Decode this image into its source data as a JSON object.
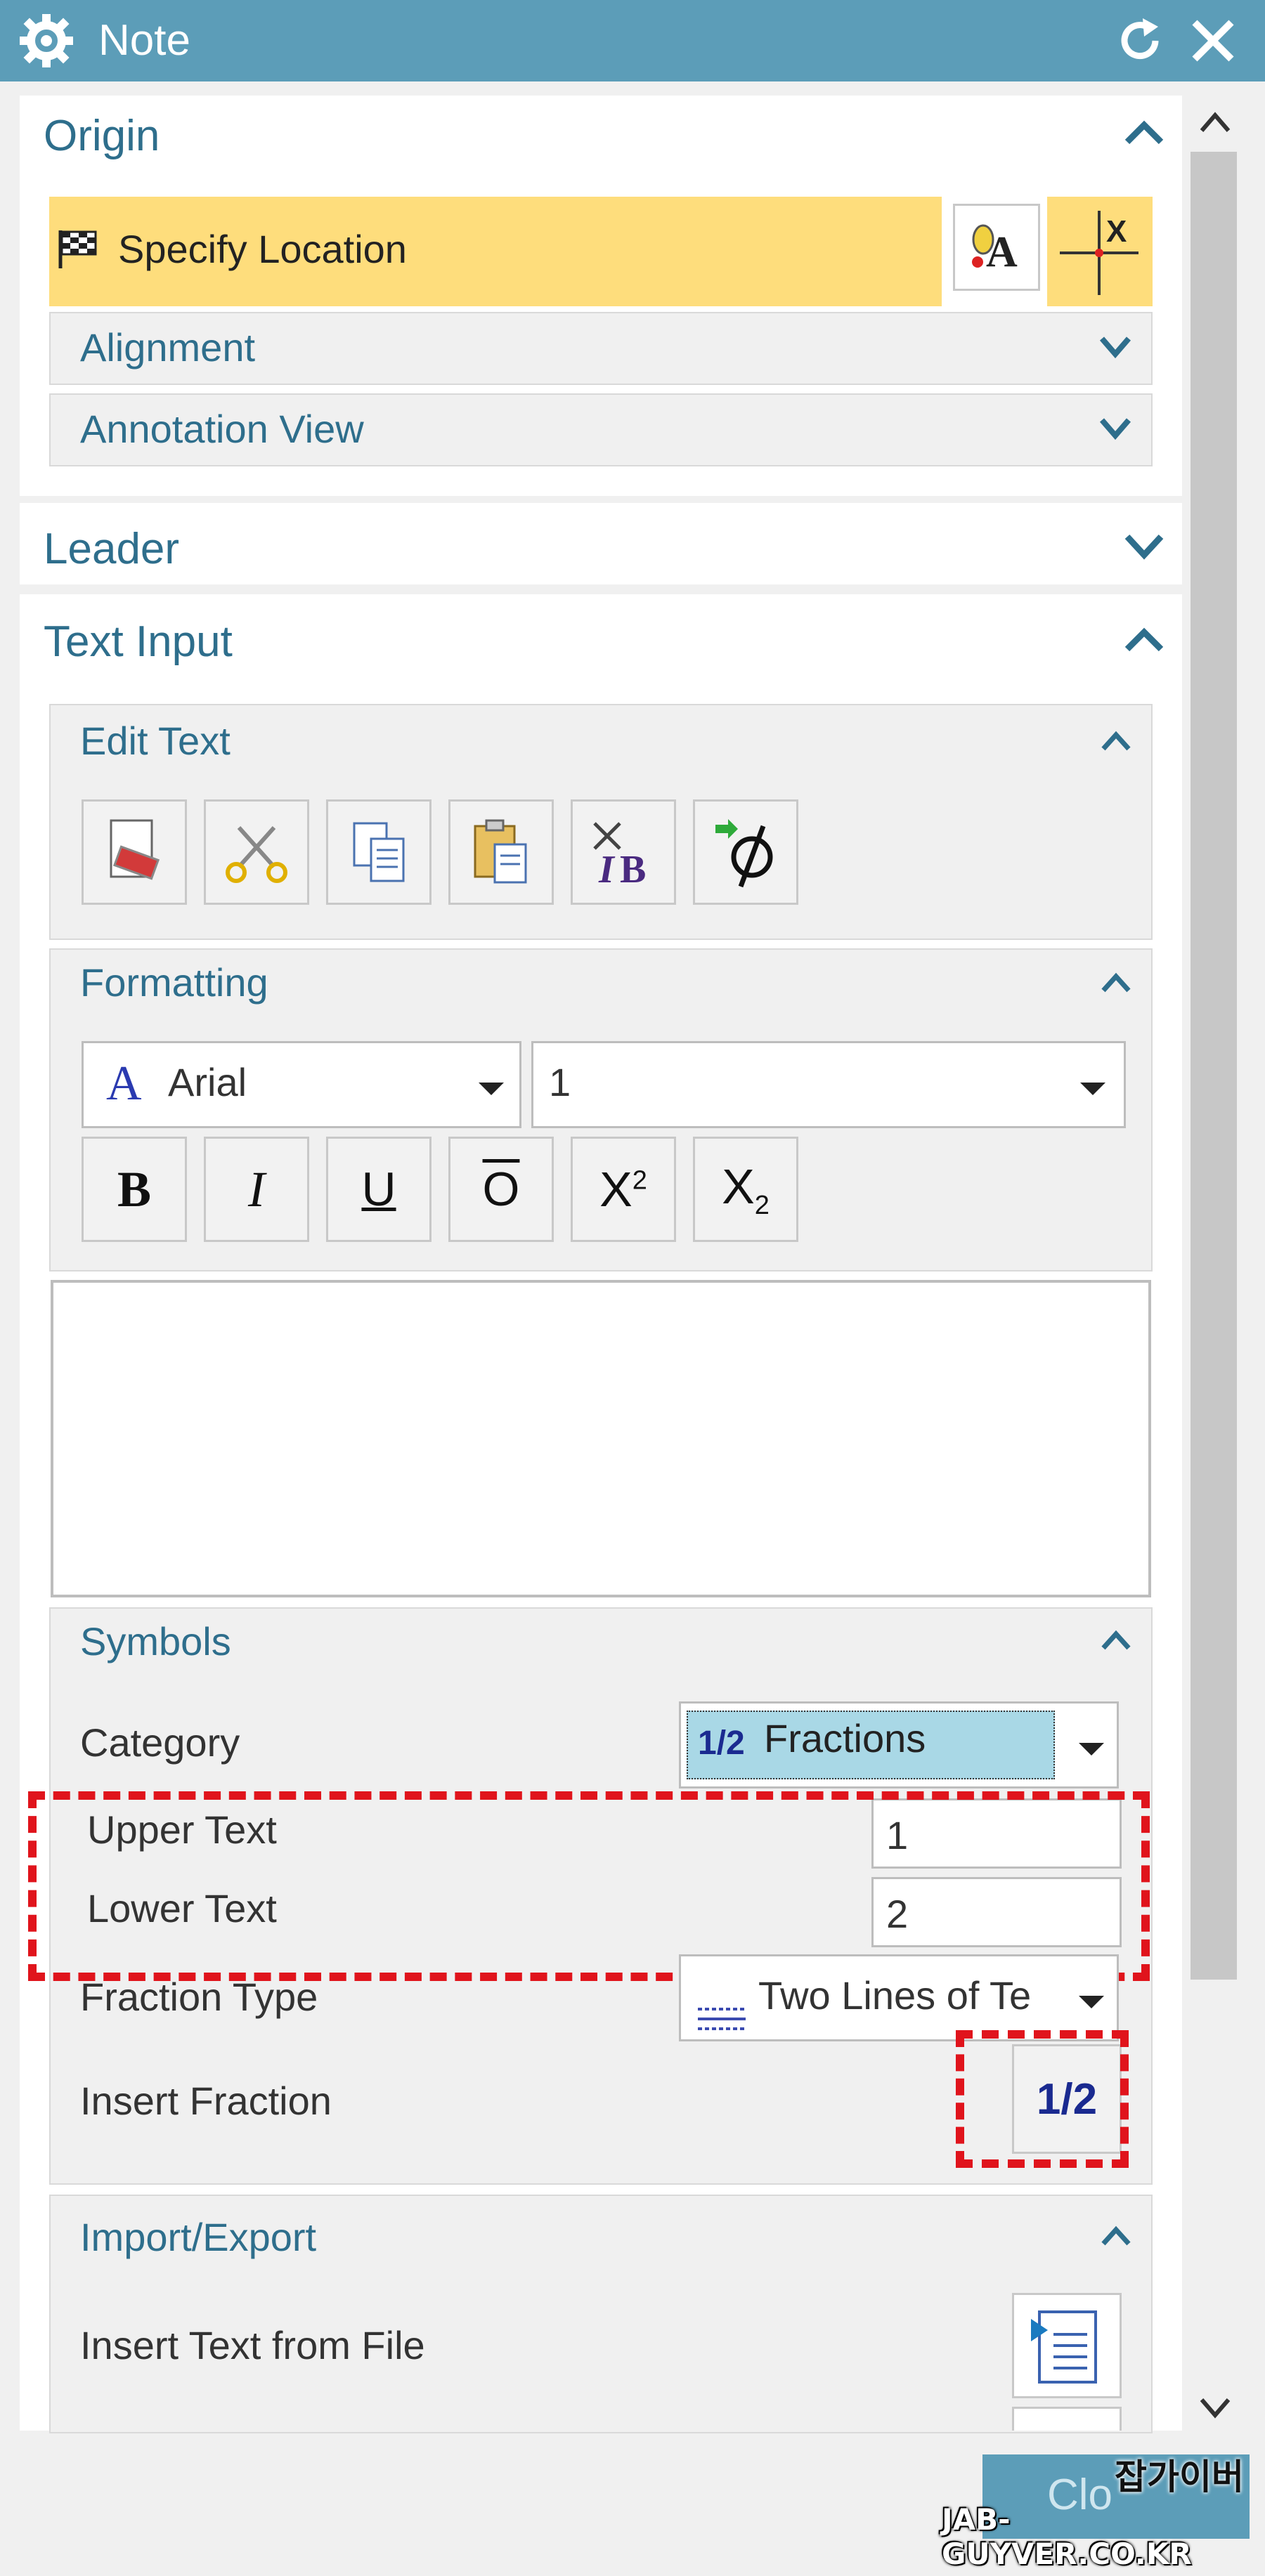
{
  "window": {
    "title": "Note"
  },
  "origin": {
    "title": "Origin",
    "specify_location": "Specify Location",
    "alignment": "Alignment",
    "annotation_view": "Annotation View"
  },
  "leader": {
    "title": "Leader"
  },
  "text_input": {
    "title": "Text Input",
    "edit_text": {
      "title": "Edit Text"
    },
    "formatting": {
      "title": "Formatting",
      "font_name": "Arial",
      "font_glyph": "A",
      "size_value": "1",
      "bold": "B",
      "italic": "I",
      "underline": "U",
      "overline": "O",
      "superscript_base": "X",
      "superscript_exp": "2",
      "subscript_base": "X",
      "subscript_idx": "2"
    },
    "text_area": ""
  },
  "symbols": {
    "title": "Symbols",
    "category_label": "Category",
    "category_icon": "1/2",
    "category_value": "Fractions",
    "upper_label": "Upper Text",
    "upper_value": "1",
    "lower_label": "Lower Text",
    "lower_value": "2",
    "fraction_type_label": "Fraction Type",
    "fraction_type_value": "Two Lines of Te",
    "insert_fraction_label": "Insert Fraction",
    "insert_fraction_btn": "1/2"
  },
  "import_export": {
    "title": "Import/Export",
    "insert_text_label": "Insert Text from File"
  },
  "footer": {
    "close_button": "Clo"
  },
  "watermark": {
    "line1": "잡가이버",
    "line2": "JAB-GUYVER.CO.KR"
  },
  "colors": {
    "titlebar": "#5c9db8",
    "highlight": "#fedd7c",
    "accent_text": "#2e6e8c",
    "red_marker": "#e0141c"
  }
}
